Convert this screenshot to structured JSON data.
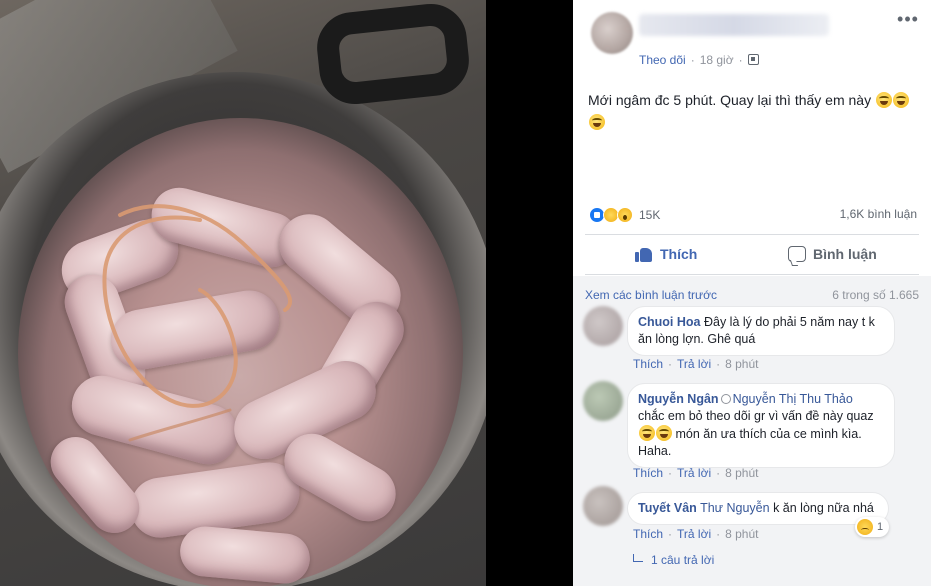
{
  "post": {
    "follow_label": "Theo dõi",
    "time": "18 giờ",
    "text": "Mới ngâm đc 5 phút. Quay lại thì thấy em này",
    "reaction_count": "15K",
    "comment_count": "1,6K bình luận",
    "like_label": "Thích",
    "comment_label": "Bình luận"
  },
  "comments_section": {
    "view_previous": "Xem các bình luận trước",
    "count": "6 trong số 1.665",
    "comments": [
      {
        "name": "Chuoi Hoa",
        "text": "Đây là lý do phải 5 năm nay t k ăn lòng lợn. Ghê quá",
        "like": "Thích",
        "reply": "Trả lời",
        "time": "8 phút"
      },
      {
        "name": "Nguyễn Ngân",
        "tag": "Nguyễn Thị Thu Thảo",
        "text_a": "chắc em bỏ theo dõi gr vì vấn đề này quaz",
        "text_b": "món ăn ưa thích của ce mình kìa. Haha.",
        "like": "Thích",
        "reply": "Trả lời",
        "time": "8 phút"
      },
      {
        "name": "Tuyết Vân",
        "tag": "Thư Nguyễn",
        "text": "k ăn lòng nữa nhá",
        "like": "Thích",
        "reply": "Trả lời",
        "time": "8 phút",
        "reaction_count": "1"
      }
    ],
    "replies_link": "1 câu trả lời"
  },
  "icons": {
    "more": "more-icon",
    "privacy": "globe-icon",
    "like": "like-icon",
    "comment": "comment-icon"
  },
  "colors": {
    "link_blue": "#4267b2",
    "name_blue": "#385898",
    "comment_bg": "#f2f3f5"
  }
}
